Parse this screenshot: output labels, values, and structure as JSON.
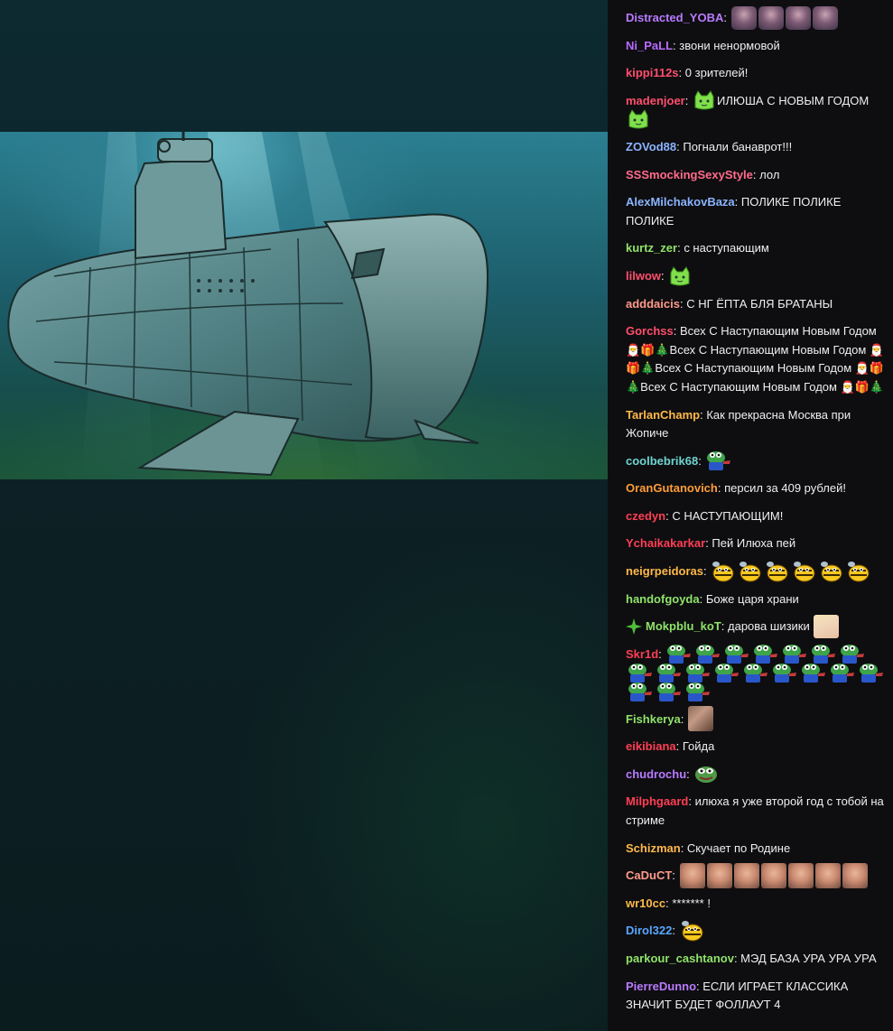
{
  "colors": {
    "chat_bg": "#0e0e10",
    "text": "#efeff1",
    "violet": "#b36bff",
    "pink": "#ff4f7a",
    "red": "#ff3e54",
    "blue": "#8ab4ff",
    "green": "#8fe36a",
    "orange": "#ffb94a",
    "coral": "#ff9a8a",
    "teal": "#6fd4d0"
  },
  "chat": {
    "messages": [
      {
        "user": "Distracted_YOBA",
        "color": "#b97bff",
        "text": "",
        "emotes": [
          "face",
          "face",
          "face",
          "face"
        ]
      },
      {
        "user": "Ni_PaLL",
        "color": "#b86bff",
        "text": "звони ненормовой"
      },
      {
        "user": "kippi112s",
        "color": "#ff4f6d",
        "text": "0 зрителей!"
      },
      {
        "user": "madenjoer",
        "color": "#ff4f6d",
        "text": "ИЛЮША С НОВЫМ ГОДОМ",
        "emotes_before": [
          "cat"
        ],
        "emotes_after": [
          "cat"
        ]
      },
      {
        "user": "ZOVod88",
        "color": "#8ab4ff",
        "text": "Погнали банаврот!!!"
      },
      {
        "user": "SSSmockingSexyStyle",
        "color": "#ff6b8c",
        "text": "лол"
      },
      {
        "user": "AlexMilchakovBaza",
        "color": "#8ab4ff",
        "text": "ПОЛИКЕ ПОЛИКЕ ПОЛИКЕ"
      },
      {
        "user": "kurtz_zer",
        "color": "#8fe36a",
        "text": "с наступающим"
      },
      {
        "user": "lilwow",
        "color": "#ff4f6d",
        "text": "",
        "emotes": [
          "cat"
        ]
      },
      {
        "user": "adddaicis",
        "color": "#ff9a8a",
        "text": "С НГ ЁПТА БЛЯ БРАТАНЫ"
      },
      {
        "user": "Gorchss",
        "color": "#ff4f6d",
        "text": "Всех С Наступающим Новым Годом 🎅🎁🎄Всех С Наступающим Новым Годом 🎅🎁🎄Всех С Наступающим Новым Годом 🎅🎁🎄Всех С Наступающим Новым Годом 🎅🎁🎄"
      },
      {
        "user": "TarlanChamp",
        "color": "#ffb94a",
        "text": "Как прекрасна Москва при Жопиче"
      },
      {
        "user": "coolbebrik68",
        "color": "#6fd4d0",
        "text": "",
        "emotes": [
          "frog"
        ]
      },
      {
        "user": "OranGutanovich",
        "color": "#ff9d3a",
        "text": "персил за 409 рублей!"
      },
      {
        "user": "czedyn",
        "color": "#ff3e54",
        "text": "С НАСТУПАЮЩИМ!"
      },
      {
        "user": "Ychaikakarkar",
        "color": "#ff3e54",
        "text": "Пей Илюха пей"
      },
      {
        "user": "neigrpeidoras",
        "color": "#ffb94a",
        "text": "",
        "emotes": [
          "bee",
          "bee",
          "bee",
          "bee",
          "bee",
          "bee"
        ]
      },
      {
        "user": "handofgoyda",
        "color": "#8fe36a",
        "text": "Боже царя храни"
      },
      {
        "user": "Mokpblu_koT",
        "color": "#8fe36a",
        "text": "дарова шизики",
        "badge": "sparkle",
        "emotes": [
          "anime"
        ]
      },
      {
        "user": "Skr1d",
        "color": "#ff3e54",
        "text": "",
        "emotes": [
          "frog",
          "frog",
          "frog",
          "frog",
          "frog",
          "frog",
          "frog",
          "frog",
          "frog",
          "frog",
          "frog",
          "frog",
          "frog",
          "frog",
          "frog",
          "frog",
          "frog",
          "frog",
          "frog"
        ]
      },
      {
        "user": "Fishkerya",
        "color": "#8fe36a",
        "text": "",
        "emotes": [
          "hand"
        ]
      },
      {
        "user": "eikibiana",
        "color": "#ff3e54",
        "text": "Гойда"
      },
      {
        "user": "chudrochu",
        "color": "#b97bff",
        "text": "",
        "emotes": [
          "pepe"
        ]
      },
      {
        "user": "Milphgaard",
        "color": "#ff3e54",
        "text": "илюха я уже второй год с тобой на стриме"
      },
      {
        "user": "Schizman",
        "color": "#ffb94a",
        "text": "Скучает по Родине"
      },
      {
        "user": "CaDuCT",
        "color": "#ff9a8a",
        "text": "",
        "emotes": [
          "caduct",
          "caduct",
          "caduct",
          "caduct",
          "caduct",
          "caduct",
          "caduct"
        ]
      },
      {
        "user": "wr10cc",
        "color": "#ffb94a",
        "text": "******* !"
      },
      {
        "user": "Dirol322",
        "color": "#5aa6ff",
        "text": "",
        "emotes": [
          "bee"
        ]
      },
      {
        "user": "parkour_cashtanov",
        "color": "#8fe36a",
        "text": "МЭД БАЗА УРА УРА УРА"
      },
      {
        "user": "PierreDunno",
        "color": "#b97bff",
        "text": "ЕСЛИ ИГРАЕТ КЛАССИКА ЗНАЧИТ БУДЕТ ФОЛЛАУТ 4"
      }
    ]
  }
}
